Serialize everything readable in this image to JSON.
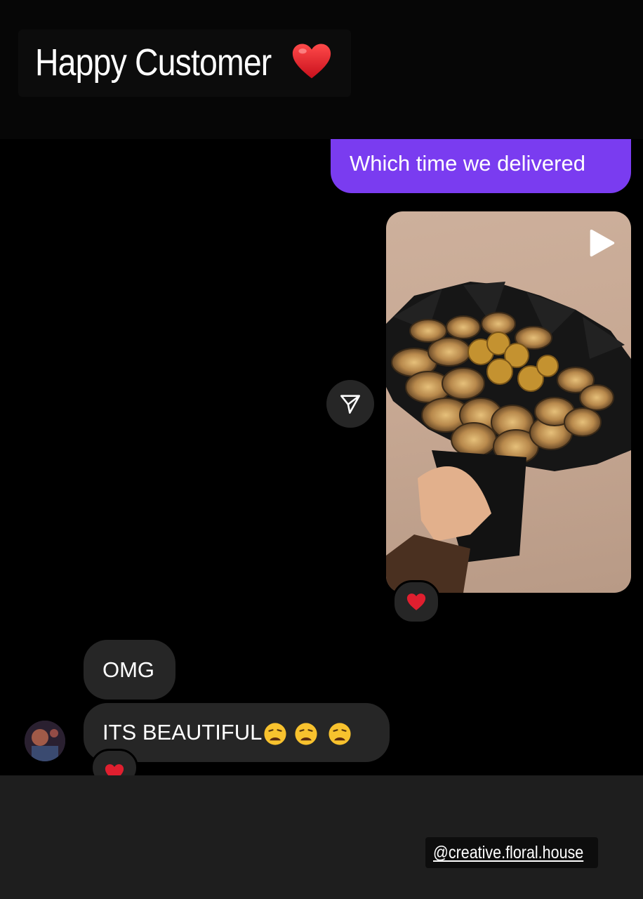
{
  "header": {
    "title": "Happy Customer"
  },
  "messages": {
    "outgoing_text": "Which time we delivered",
    "incoming": [
      {
        "text": "OMG"
      },
      {
        "text": "ITS BEAUTIFUL"
      }
    ]
  },
  "footer": {
    "handle": "@creative.floral.house"
  },
  "colors": {
    "outgoing_bubble": "#7a3cf0",
    "incoming_bubble": "#262626",
    "reaction_heart": "#e01f2f"
  },
  "icons": {
    "title_heart": "heart-icon",
    "media": "play-icon",
    "share": "send-icon",
    "reaction": "heart-icon",
    "emoji": "weary-face-icon"
  }
}
